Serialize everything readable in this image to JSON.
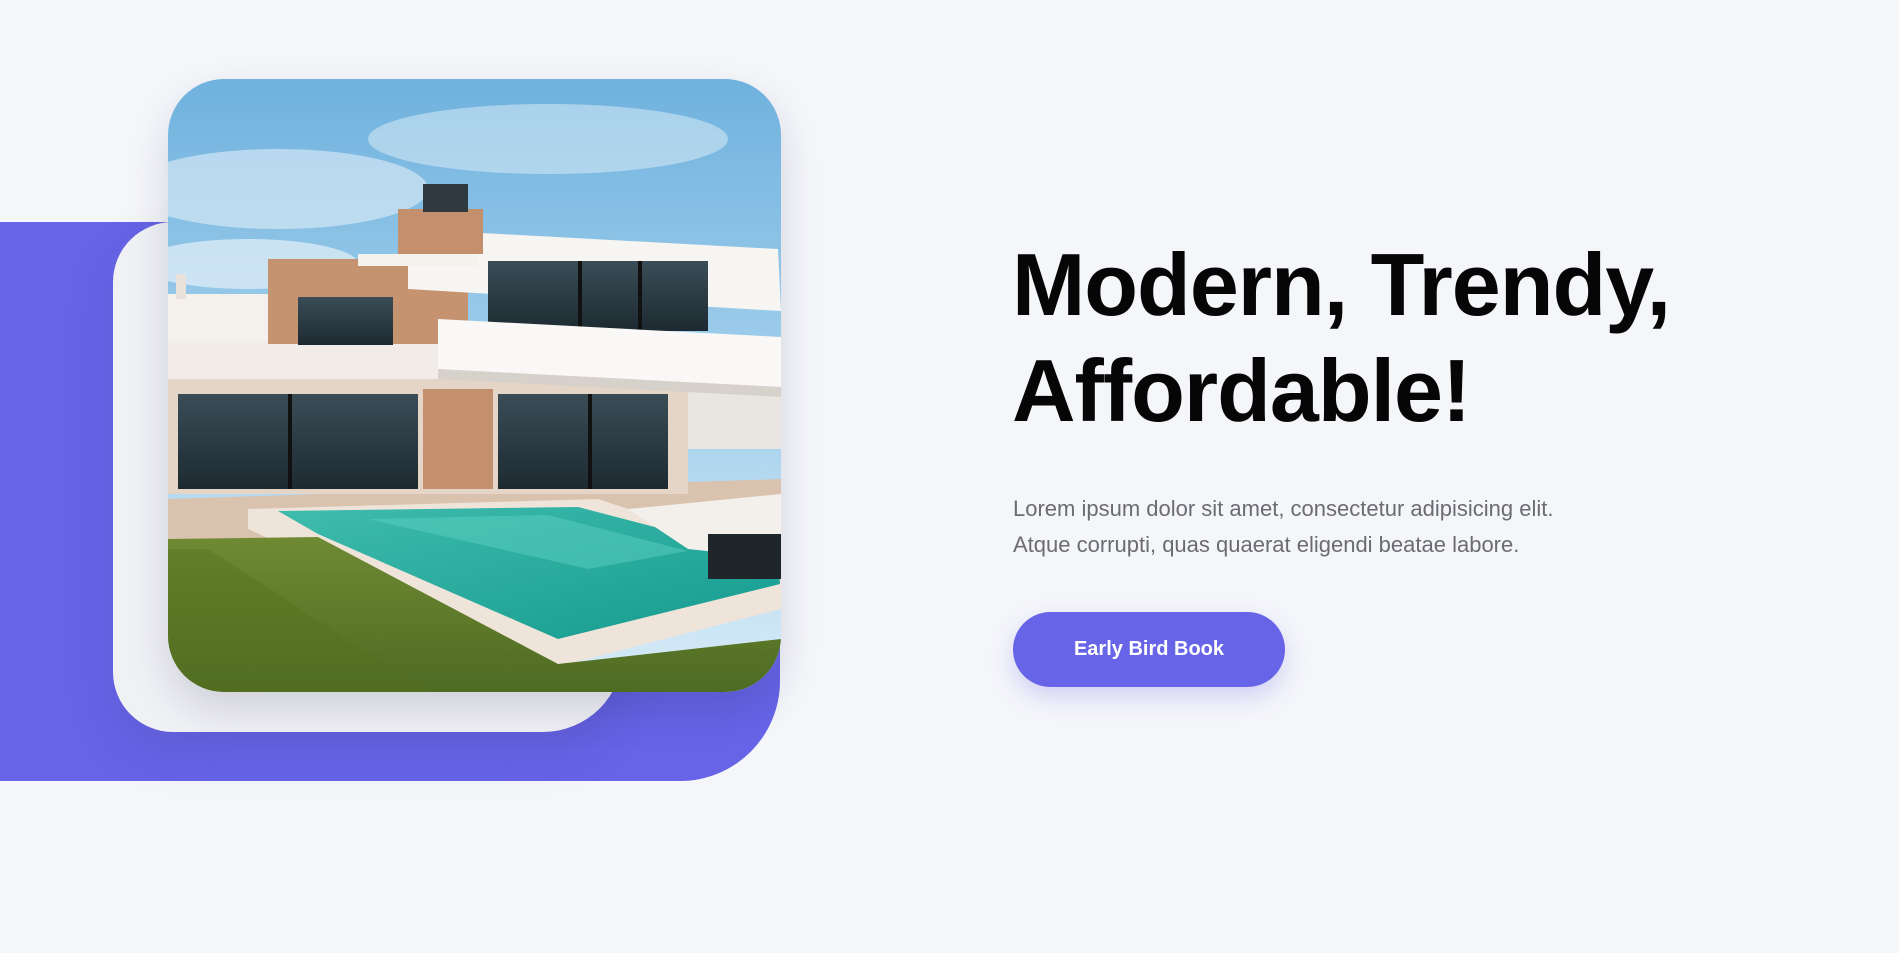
{
  "hero": {
    "title_line1": "Modern, Trendy,",
    "title_line2": "Affordable!",
    "description_line1": "Lorem ipsum dolor sit amet, consectetur adipisicing elit.",
    "description_line2": "Atque corrupti, quas quaerat eligendi beatae labore.",
    "cta_label": "Early Bird Book"
  },
  "colors": {
    "background": "#f5f6fa",
    "accent": "#6764e8",
    "title": "#060606",
    "body_text": "#6b6b72",
    "button_text": "#ffffff"
  },
  "images": {
    "hero_photo": "modern-villa-with-pool"
  }
}
